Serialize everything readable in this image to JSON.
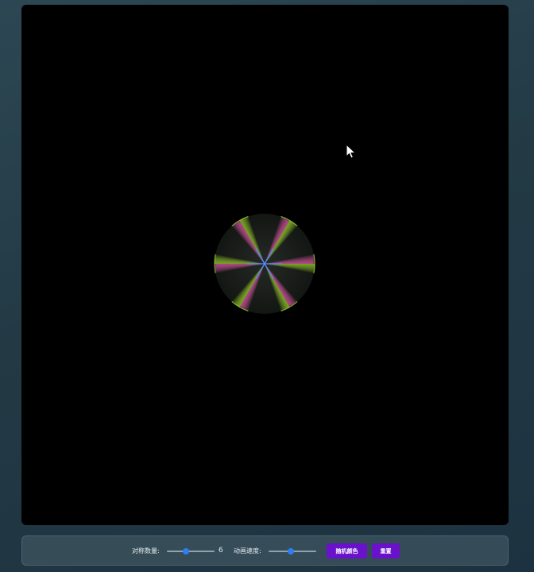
{
  "controls": {
    "symmetry_label": "对称数量:",
    "symmetry_value": 6,
    "symmetry_value_text": "6",
    "symmetry_slider_fraction": 0.4,
    "speed_label": "动画速度:",
    "speed_slider_fraction": 0.47,
    "random_color_label": "随机颜色",
    "reset_label": "重置"
  },
  "colors": {
    "page_background": "#263e4a",
    "canvas_background": "#000000",
    "button": "#6a11cb",
    "slider_thumb": "#2f7df6",
    "pattern_pink": "#e25bb0",
    "pattern_green": "#9acd32",
    "pattern_blue": "#5a8bff"
  },
  "icons": {
    "cursor": "arrow-cursor-icon"
  }
}
